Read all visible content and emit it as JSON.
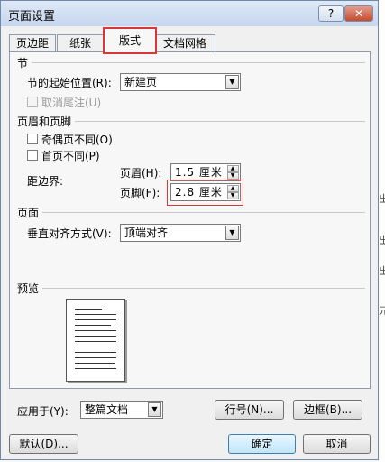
{
  "window": {
    "title": "页面设置",
    "help_glyph": "?",
    "close_glyph": "✕"
  },
  "tabs": [
    {
      "label": "页边距",
      "active": false
    },
    {
      "label": "纸张",
      "active": false
    },
    {
      "label": "版式",
      "active": true
    },
    {
      "label": "文档网格",
      "active": false
    }
  ],
  "section": {
    "heading": "节",
    "start_label": "节的起始位置(R):",
    "start_value": "新建页",
    "suppress_endnotes_label": "取消尾注(U)",
    "suppress_endnotes_checked": false,
    "suppress_endnotes_disabled": true
  },
  "headers_footers": {
    "heading": "页眉和页脚",
    "odd_even_label": "奇偶页不同(O)",
    "odd_even_checked": false,
    "first_page_label": "首页不同(P)",
    "first_page_checked": false,
    "from_edge_label": "距边界:",
    "header_label": "页眉(H):",
    "header_value": "1.5 厘米",
    "footer_label": "页脚(F):",
    "footer_value": "2.8 厘米"
  },
  "page": {
    "heading": "页面",
    "valign_label": "垂直对齐方式(V):",
    "valign_value": "顶端对齐"
  },
  "preview": {
    "heading": "预览"
  },
  "apply_to": {
    "label": "应用于(Y):",
    "value": "整篇文档"
  },
  "buttons": {
    "line_numbers": "行号(N)...",
    "borders": "边框(B)...",
    "default": "默认(D)...",
    "ok": "确定",
    "cancel": "取消"
  },
  "highlight_color": "#d8373b",
  "background_text": [
    "出",
    "出",
    "出",
    "出",
    "出",
    "元"
  ]
}
